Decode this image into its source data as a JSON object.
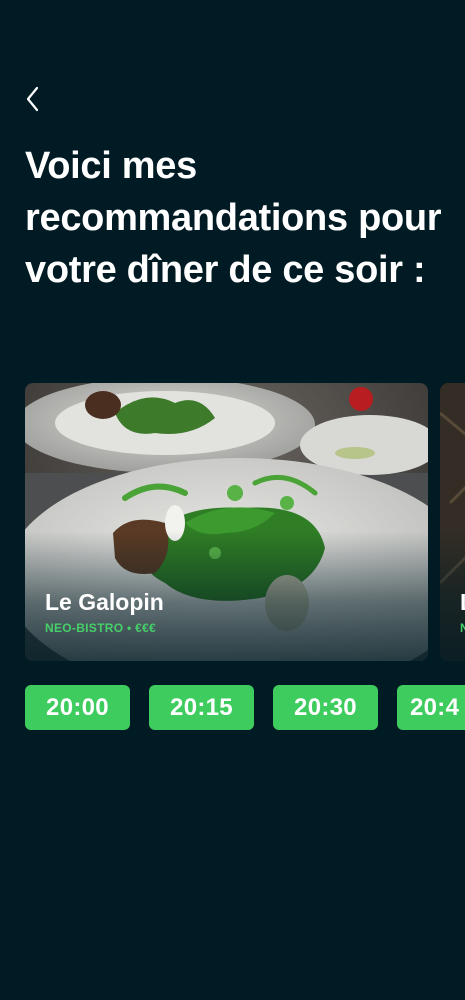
{
  "header": {
    "back_icon": "chevron-left-icon",
    "title": "Voici mes recommandations pour votre dîner de ce soir :"
  },
  "restaurants": [
    {
      "name": "Le Galopin",
      "meta": "NEO-BISTRO • €€€"
    },
    {
      "name": "L",
      "meta": "N"
    }
  ],
  "time_slots": [
    "20:00",
    "20:15",
    "20:30",
    "20:4"
  ],
  "colors": {
    "background": "#011b24",
    "accent": "#3fcc5f",
    "meta_text": "#46d06a"
  }
}
